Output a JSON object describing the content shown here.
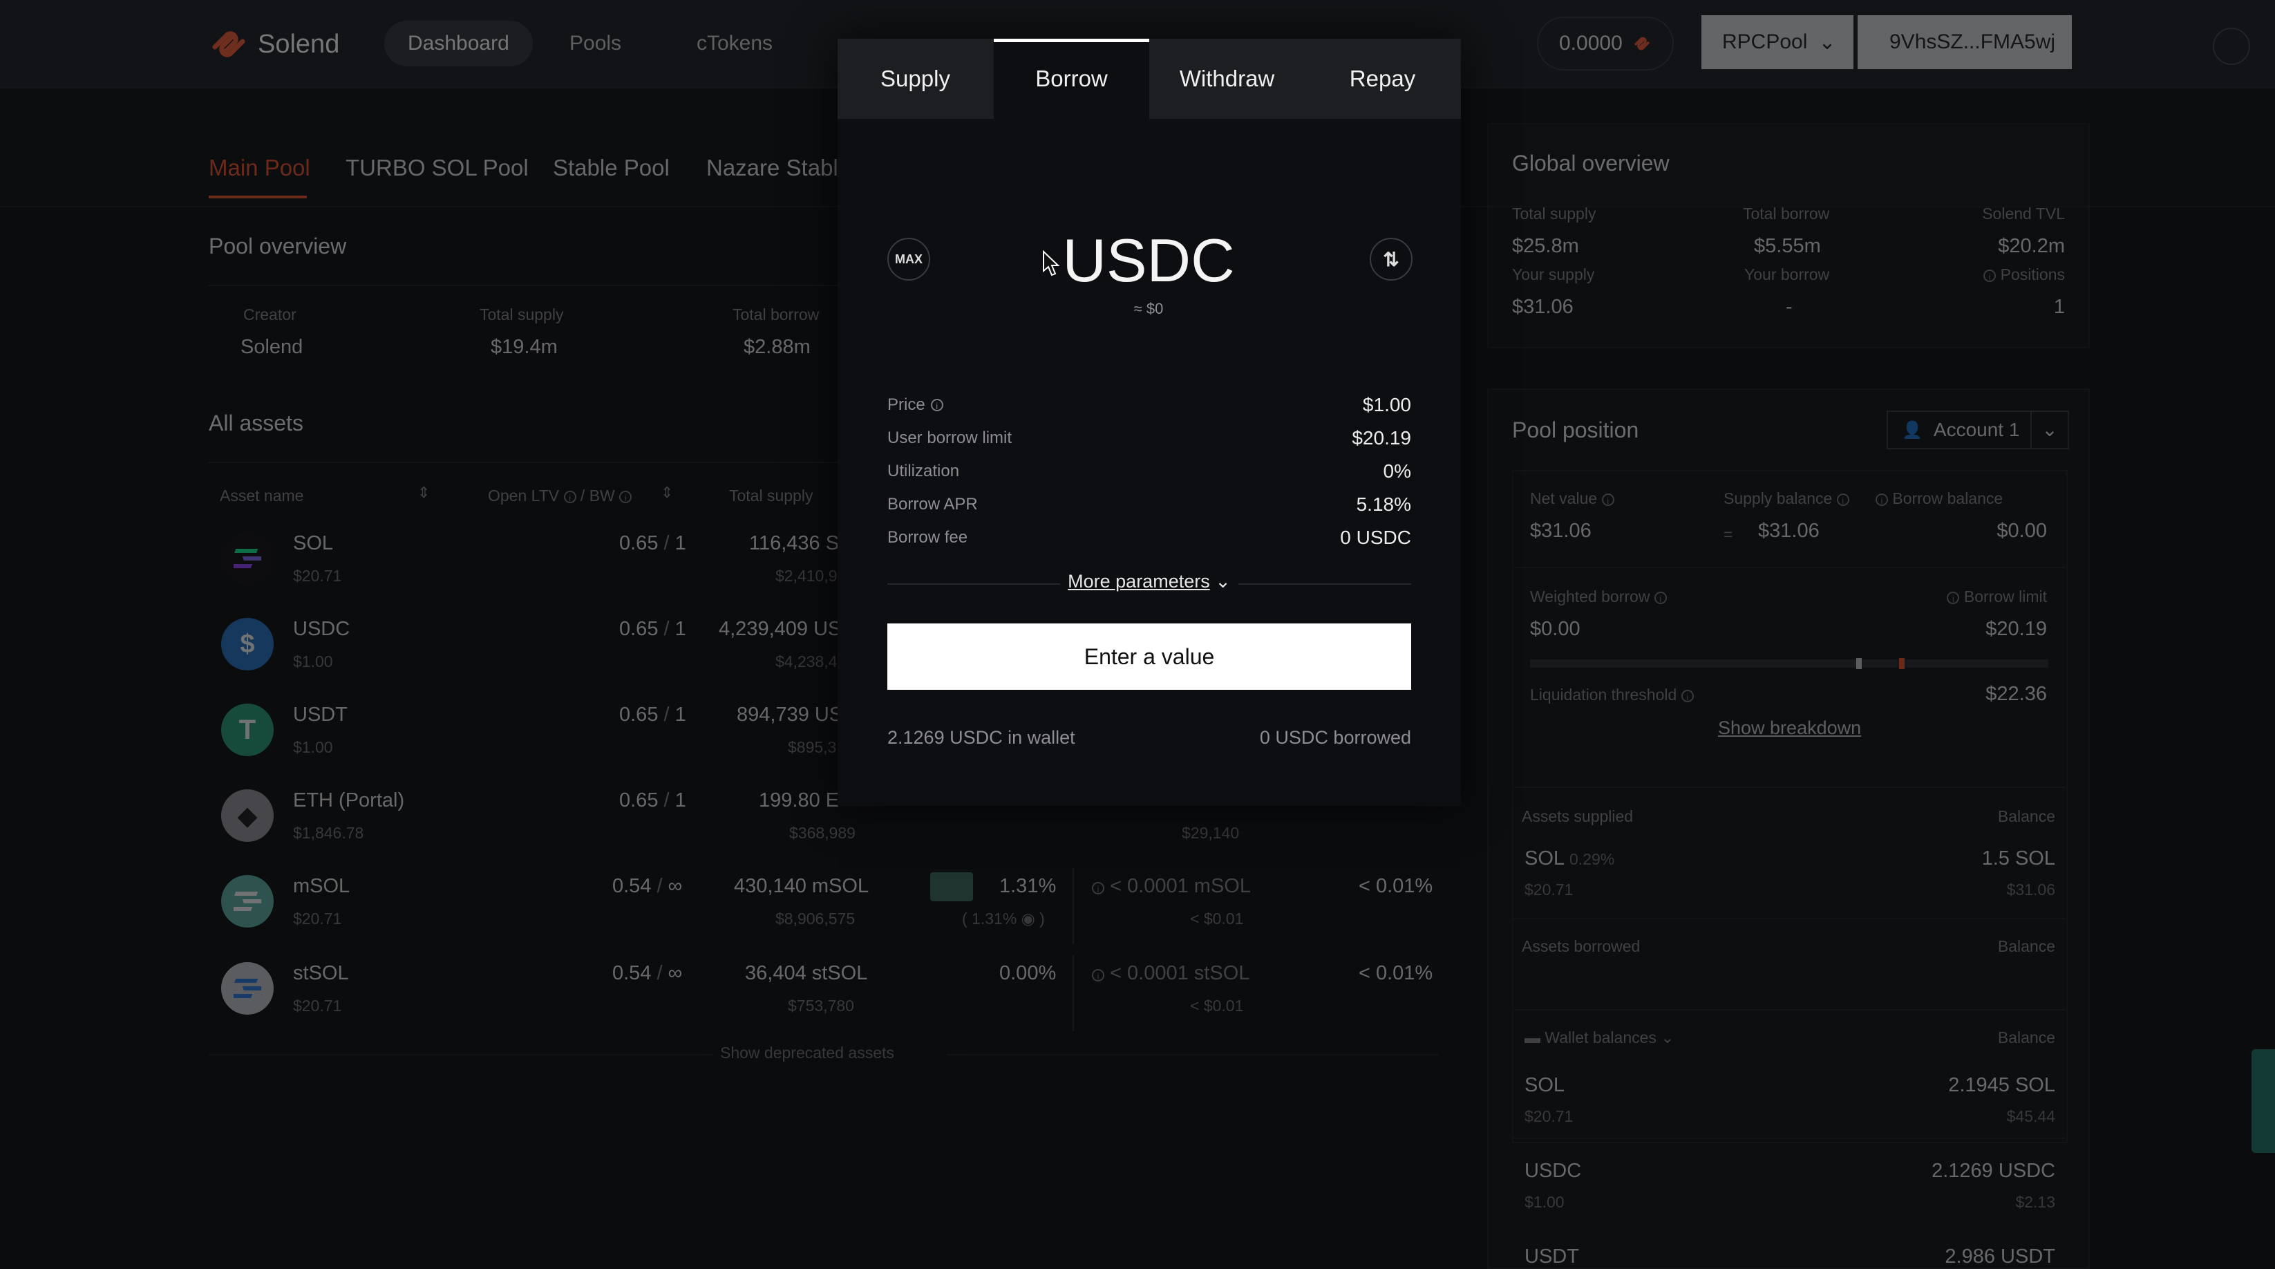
{
  "header": {
    "brand": "Solend",
    "nav": [
      "Dashboard",
      "Pools",
      "cTokens"
    ],
    "balance": "0.0000",
    "rpc_label": "RPCPool",
    "wallet_label": "9VhsSZ...FMA5wj"
  },
  "pool_tabs": [
    "Main Pool",
    "TURBO SOL Pool",
    "Stable Pool",
    "Nazare Stable"
  ],
  "pool_overview": {
    "title": "Pool overview",
    "creator_label": "Creator",
    "creator_value": "Solend",
    "total_supply_label": "Total supply",
    "total_supply_value": "$19.4m",
    "total_borrow_label": "Total borrow",
    "total_borrow_value": "$2.88m"
  },
  "all_assets": {
    "title": "All assets",
    "columns": [
      "Asset name",
      "Open LTV",
      "BW",
      "Total supply"
    ],
    "rows": [
      {
        "name": "SOL",
        "price": "$20.71",
        "ltv": "0.65",
        "bw": "1",
        "supply": "116,436 S",
        "supply_usd": "$2,410,9"
      },
      {
        "name": "USDC",
        "price": "$1.00",
        "ltv": "0.65",
        "bw": "1",
        "supply": "4,239,409 US",
        "supply_usd": "$4,238,4"
      },
      {
        "name": "USDT",
        "price": "$1.00",
        "ltv": "0.65",
        "bw": "1",
        "supply": "894,739 US",
        "supply_usd": "$895,3"
      },
      {
        "name": "ETH (Portal)",
        "price": "$1,846.78",
        "ltv": "0.65",
        "bw": "1",
        "supply": "199.80 E",
        "supply_usd": "$368,989",
        "c2": "29,140"
      },
      {
        "name": "mSOL",
        "price": "$20.71",
        "ltv": "0.54",
        "bw": "∞",
        "supply": "430,140 mSOL",
        "supply_usd": "$8,906,575",
        "apy": "1.31%",
        "apy_sub": "( 1.31%",
        "borrow": "< 0.0001 mSOL",
        "borrow_usd": "< $0.01",
        "util": "< 0.01%"
      },
      {
        "name": "stSOL",
        "price": "$20.71",
        "ltv": "0.54",
        "bw": "∞",
        "supply": "36,404 stSOL",
        "supply_usd": "$753,780",
        "apy": "0.00%",
        "borrow": "< 0.0001 stSOL",
        "borrow_usd": "< $0.01",
        "util": "< 0.01%"
      }
    ],
    "show_deprecated": "Show deprecated assets"
  },
  "global_overview": {
    "title": "Global overview",
    "total_supply_label": "Total supply",
    "total_supply": "$25.8m",
    "total_borrow_label": "Total borrow",
    "total_borrow": "$5.55m",
    "tvl_label": "Solend TVL",
    "tvl": "$20.2m",
    "your_supply_label": "Your supply",
    "your_supply": "$31.06",
    "your_borrow_label": "Your borrow",
    "your_borrow": "-",
    "positions_label": "Positions",
    "positions": "1"
  },
  "pool_position": {
    "title": "Pool position",
    "account": "Account 1",
    "net_value_label": "Net value",
    "net_value": "$31.06",
    "supply_balance_label": "Supply balance",
    "supply_balance": "$31.06",
    "borrow_balance_label": "Borrow balance",
    "borrow_balance": "$0.00",
    "weighted_borrow_label": "Weighted borrow",
    "weighted_borrow": "$0.00",
    "borrow_limit_label": "Borrow limit",
    "borrow_limit": "$20.19",
    "liq_label": "Liquidation threshold",
    "liq_value": "$22.36",
    "show_breakdown": "Show breakdown",
    "assets_supplied_label": "Assets supplied",
    "balance_label": "Balance",
    "supplied_asset": "SOL",
    "supplied_pct": "0.29%",
    "supplied_price": "$20.71",
    "supplied_amount": "1.5 SOL",
    "supplied_usd": "$31.06",
    "assets_borrowed_label": "Assets borrowed",
    "wallet_balances_label": "Wallet balances",
    "wallet": [
      {
        "asset": "SOL",
        "price": "$20.71",
        "amount": "2.1945 SOL",
        "usd": "$45.44"
      },
      {
        "asset": "USDC",
        "price": "$1.00",
        "amount": "2.1269 USDC",
        "usd": "$2.13"
      },
      {
        "asset": "USDT",
        "amount": "2.986 USDT"
      }
    ]
  },
  "modal": {
    "tabs": [
      "Supply",
      "Borrow",
      "Withdraw",
      "Repay"
    ],
    "active_tab": "Borrow",
    "max_label": "MAX",
    "token": "USDC",
    "usd_equiv": "≈ $0",
    "params": [
      {
        "label": "Price",
        "value": "$1.00"
      },
      {
        "label": "User borrow limit",
        "value": "$20.19"
      },
      {
        "label": "Utilization",
        "value": "0%"
      },
      {
        "label": "Borrow APR",
        "value": "5.18%"
      },
      {
        "label": "Borrow fee",
        "value": "0 USDC"
      }
    ],
    "more_params": "More parameters",
    "cta": "Enter a value",
    "wallet_text": "2.1269 USDC in wallet",
    "borrowed_text": "0 USDC borrowed"
  },
  "colors": {
    "accent": "#f2542d",
    "bg": "#0b0c0e",
    "modal": "#0d0e11"
  }
}
